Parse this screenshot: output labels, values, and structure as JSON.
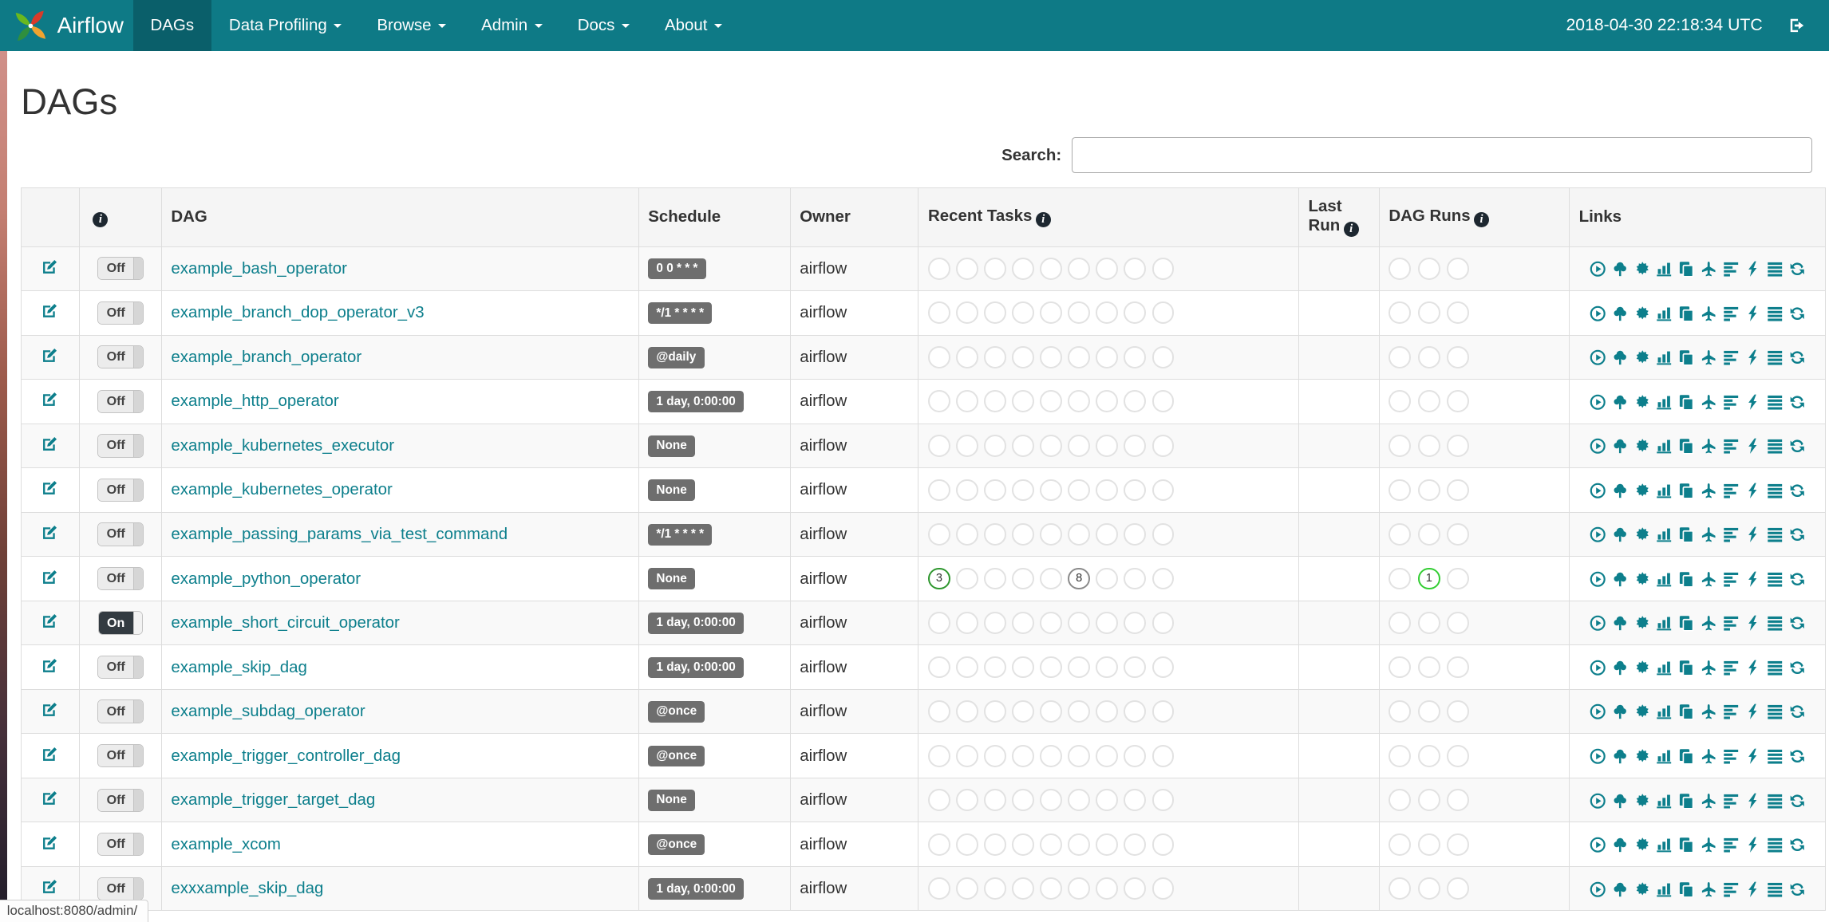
{
  "navbar": {
    "brand": "Airflow",
    "items": [
      {
        "label": "DAGs",
        "active": true,
        "caret": false
      },
      {
        "label": "Data Profiling",
        "active": false,
        "caret": true
      },
      {
        "label": "Browse",
        "active": false,
        "caret": true
      },
      {
        "label": "Admin",
        "active": false,
        "caret": true
      },
      {
        "label": "Docs",
        "active": false,
        "caret": true
      },
      {
        "label": "About",
        "active": false,
        "caret": true
      }
    ],
    "clock": "2018-04-30 22:18:34 UTC"
  },
  "page": {
    "title": "DAGs"
  },
  "search": {
    "label": "Search:",
    "value": "",
    "placeholder": ""
  },
  "icons": {
    "info_glyph": "i"
  },
  "colors": {
    "navbar": "#0e7a86",
    "accent": "#0d7f8c",
    "badge": "#6e6e6e",
    "success": "#2d962d",
    "running": "#32cd32",
    "queued": "#8a8a8a"
  },
  "table": {
    "headers": {
      "dag": "DAG",
      "schedule": "Schedule",
      "owner": "Owner",
      "recent_tasks": "Recent Tasks",
      "last_run": "Last Run",
      "dag_runs": "DAG Runs",
      "links": "Links"
    },
    "recent_task_slots": 9,
    "dag_run_slots": 3,
    "links_icons": [
      "trigger-dag",
      "tree-view",
      "graph-view",
      "task-duration",
      "task-tries",
      "landing-times",
      "gantt",
      "code",
      "details",
      "refresh"
    ],
    "rows": [
      {
        "dag": "example_bash_operator",
        "toggle": "Off",
        "schedule": "0 0 * * *",
        "owner": "airflow"
      },
      {
        "dag": "example_branch_dop_operator_v3",
        "toggle": "Off",
        "schedule": "*/1 * * * *",
        "owner": "airflow"
      },
      {
        "dag": "example_branch_operator",
        "toggle": "Off",
        "schedule": "@daily",
        "owner": "airflow"
      },
      {
        "dag": "example_http_operator",
        "toggle": "Off",
        "schedule": "1 day, 0:00:00",
        "owner": "airflow"
      },
      {
        "dag": "example_kubernetes_executor",
        "toggle": "Off",
        "schedule": "None",
        "owner": "airflow"
      },
      {
        "dag": "example_kubernetes_operator",
        "toggle": "Off",
        "schedule": "None",
        "owner": "airflow"
      },
      {
        "dag": "example_passing_params_via_test_command",
        "toggle": "Off",
        "schedule": "*/1 * * * *",
        "owner": "airflow"
      },
      {
        "dag": "example_python_operator",
        "toggle": "Off",
        "schedule": "None",
        "owner": "airflow",
        "recent_tasks": [
          {
            "slot": 0,
            "count": "3",
            "state": "success",
            "color": "#2d962d"
          },
          {
            "slot": 5,
            "count": "8",
            "state": "queued",
            "color": "#8a8a8a"
          }
        ],
        "dag_runs": [
          {
            "slot": 1,
            "count": "1",
            "state": "running",
            "color": "#32cd32"
          }
        ]
      },
      {
        "dag": "example_short_circuit_operator",
        "toggle": "On",
        "schedule": "1 day, 0:00:00",
        "owner": "airflow"
      },
      {
        "dag": "example_skip_dag",
        "toggle": "Off",
        "schedule": "1 day, 0:00:00",
        "owner": "airflow"
      },
      {
        "dag": "example_subdag_operator",
        "toggle": "Off",
        "schedule": "@once",
        "owner": "airflow"
      },
      {
        "dag": "example_trigger_controller_dag",
        "toggle": "Off",
        "schedule": "@once",
        "owner": "airflow"
      },
      {
        "dag": "example_trigger_target_dag",
        "toggle": "Off",
        "schedule": "None",
        "owner": "airflow"
      },
      {
        "dag": "example_xcom",
        "toggle": "Off",
        "schedule": "@once",
        "owner": "airflow"
      },
      {
        "dag": "exxxample_skip_dag",
        "toggle": "Off",
        "schedule": "1 day, 0:00:00",
        "owner": "airflow"
      }
    ]
  },
  "statusbar": {
    "text": "localhost:8080/admin/"
  }
}
